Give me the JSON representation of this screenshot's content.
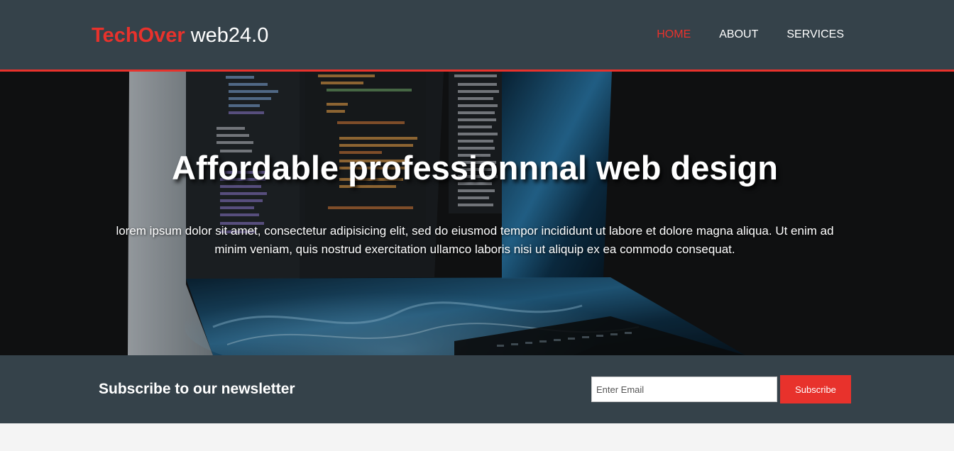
{
  "header": {
    "brand_highlight": "TechOver",
    "brand_rest": " web24.0",
    "nav": [
      {
        "label": "Home",
        "current": true
      },
      {
        "label": "About",
        "current": false
      },
      {
        "label": "Services",
        "current": false
      }
    ]
  },
  "showcase": {
    "heading": "Affordable professionnnal web design",
    "text": "lorem ipsum dolor sit amet, consectetur adipisicing elit, sed do eiusmod tempor incididunt ut labore et dolore magna aliqua. Ut enim ad minim veniam, quis nostrud exercitation ullamco laboris nisi ut aliquip ex ea commodo consequat."
  },
  "newsletter": {
    "heading": "Subscribe to our newsletter",
    "email_placeholder": "Enter Email",
    "button_label": "Subscribe"
  },
  "colors": {
    "header_bg": "#35424a",
    "accent": "#e8322c",
    "page_bg": "#f4f4f4"
  }
}
